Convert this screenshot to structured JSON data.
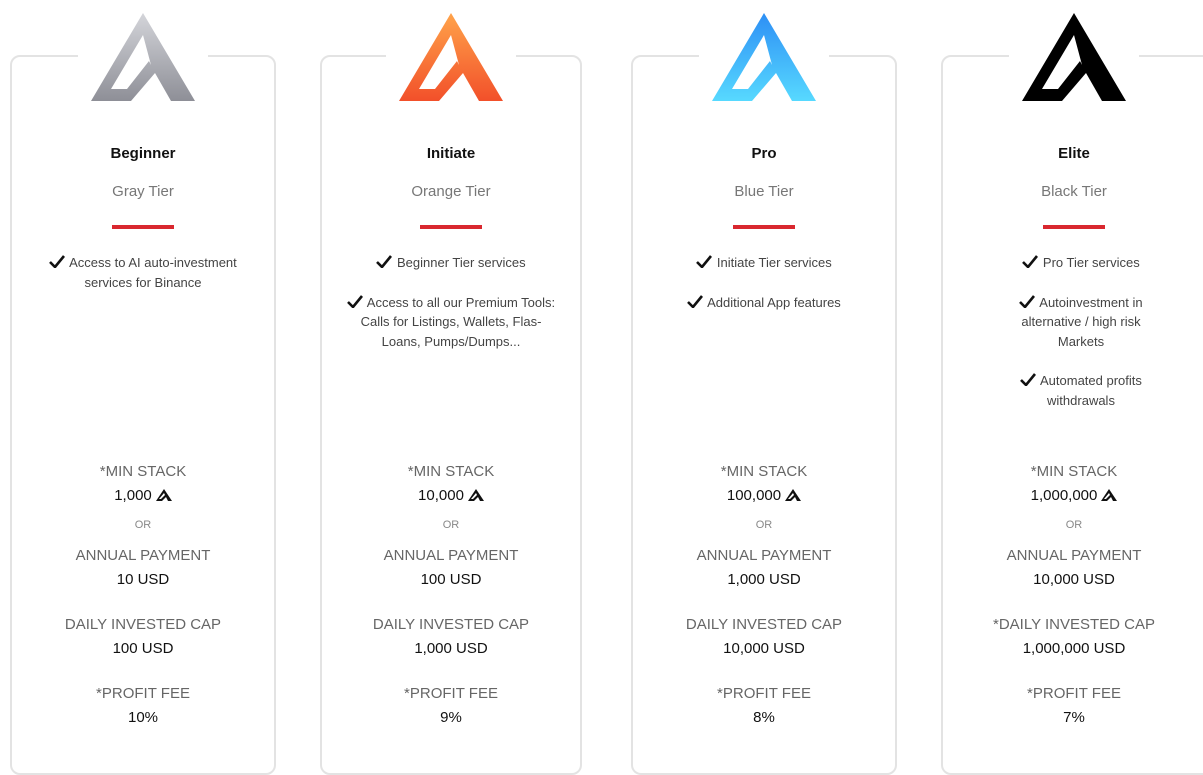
{
  "tiers": [
    {
      "name": "Beginner",
      "subtitle": "Gray Tier",
      "logo_color": "gray-gradient",
      "features": [
        "Access to AI auto-investment services for Binance"
      ],
      "min_stack_label": "*MIN STACK",
      "min_stack_value": "1,000",
      "or_label": "OR",
      "annual_label": "ANNUAL PAYMENT",
      "annual_value": "10 USD",
      "daily_label": "DAILY INVESTED CAP",
      "daily_value": "100 USD",
      "fee_label": "*PROFIT FEE",
      "fee_value": "10%"
    },
    {
      "name": "Initiate",
      "subtitle": "Orange Tier",
      "logo_color": "orange-gradient",
      "features": [
        "Beginner Tier services",
        "Access to all our Premium Tools: Calls for Listings, Wallets, Flas-Loans, Pumps/Dumps..."
      ],
      "min_stack_label": "*MIN STACK",
      "min_stack_value": "10,000",
      "or_label": "OR",
      "annual_label": "ANNUAL PAYMENT",
      "annual_value": "100 USD",
      "daily_label": "DAILY INVESTED CAP",
      "daily_value": "1,000 USD",
      "fee_label": "*PROFIT FEE",
      "fee_value": "9%"
    },
    {
      "name": "Pro",
      "subtitle": "Blue Tier",
      "logo_color": "blue-gradient",
      "features": [
        "Initiate Tier services",
        "Additional App features"
      ],
      "min_stack_label": "*MIN STACK",
      "min_stack_value": "100,000",
      "or_label": "OR",
      "annual_label": "ANNUAL PAYMENT",
      "annual_value": "1,000 USD",
      "daily_label": "DAILY INVESTED CAP",
      "daily_value": "10,000 USD",
      "fee_label": "*PROFIT FEE",
      "fee_value": "8%"
    },
    {
      "name": "Elite",
      "subtitle": "Black Tier",
      "logo_color": "black",
      "features": [
        "Pro Tier services",
        "Autoinvestment in alternative / high risk Markets",
        "Automated profits withdrawals"
      ],
      "min_stack_label": "*MIN STACK",
      "min_stack_value": "1,000,000",
      "or_label": "OR",
      "annual_label": "ANNUAL PAYMENT",
      "annual_value": "10,000 USD",
      "daily_label": "*DAILY INVESTED CAP",
      "daily_value": "1,000,000 USD",
      "fee_label": "*PROFIT FEE",
      "fee_value": "7%"
    }
  ],
  "colors": {
    "divider": "#d9282f",
    "card_border": "#e3e3e3",
    "label": "#666666",
    "value": "#111111"
  },
  "icons": {
    "tier_logo": "tier-logo-icon",
    "feature_check": "check-icon",
    "token": "token-icon"
  }
}
